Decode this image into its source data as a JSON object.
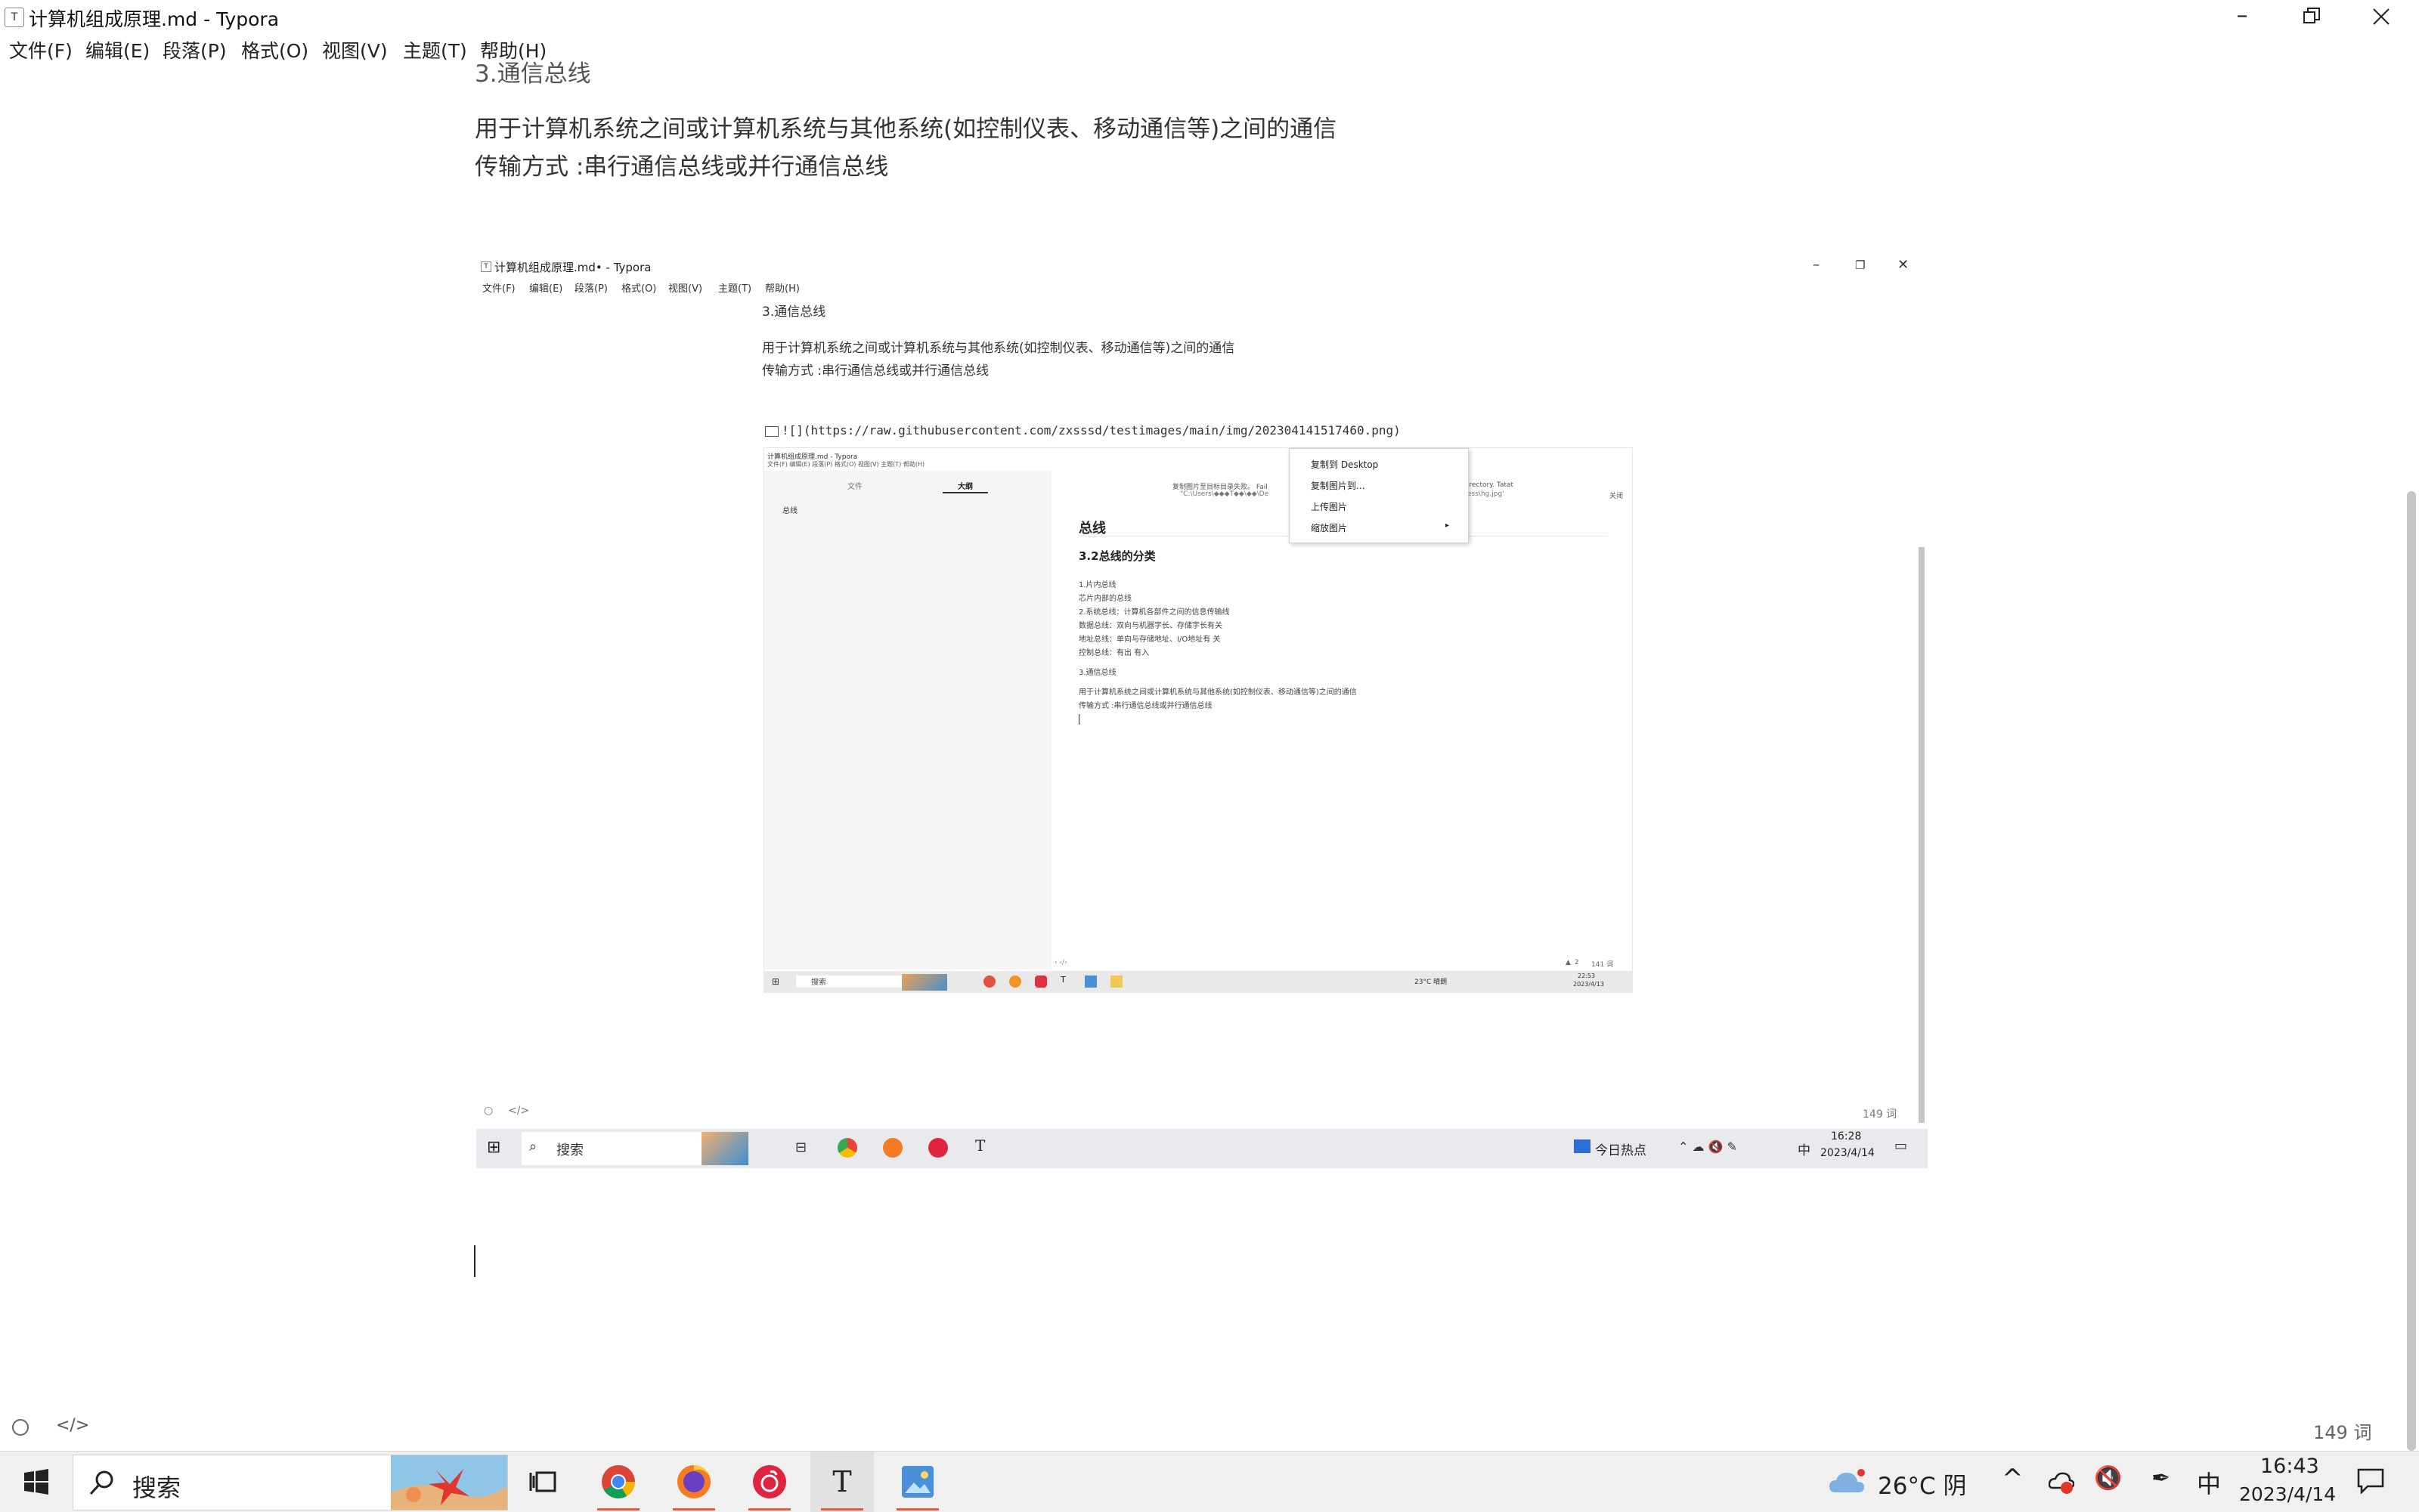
{
  "window": {
    "title": "计算机组成原理.md - Typora",
    "app_icon_letter": "T"
  },
  "menu": [
    "文件(F)",
    "编辑(E)",
    "段落(P)",
    "格式(O)",
    "视图(V)",
    "主题(T)",
    "帮助(H)"
  ],
  "doc": {
    "heading_partial": "3.通信总线",
    "line1": "用于计算机系统之间或计算机系统与其他系统(如控制仪表、移动通信等)之间的通信",
    "line2": "传输方式 :串行通信总线或并行通信总线"
  },
  "status": {
    "word_count": "149 词"
  },
  "taskbar": {
    "search_placeholder": "搜索",
    "weather": "26°C 阴",
    "ime": "中",
    "time": "16:43",
    "date": "2023/4/14"
  },
  "shot": {
    "title": "计算机组成原理.md• - Typora",
    "menu": [
      "文件(F)",
      "编辑(E)",
      "段落(P)",
      "格式(O)",
      "视图(V)",
      "主题(T)",
      "帮助(H)"
    ],
    "heading": "3.通信总线",
    "line1": "用于计算机系统之间或计算机系统与其他系统(如控制仪表、移动通信等)之间的通信",
    "line2": "传输方式 :串行通信总线或并行通信总线",
    "image_source": "![](https://raw.githubusercontent.com/zxsssd/testimages/main/img/202304141517460.png)",
    "word_count": "149 词",
    "taskbar_search": "搜索",
    "news": "今日热点",
    "ime": "中",
    "time": "16:28",
    "date": "2023/4/14"
  },
  "inner": {
    "title": "计算机组成原理.md - Typora",
    "menu": "文件(F)  编辑(E)  段落(P)  格式(O)  视图(V)  主题(T)  帮助(H)",
    "tab_files": "文件",
    "tab_outline": "大纲",
    "outline_item": "总线",
    "error_line1": "复制图片至目标目录失败。 Fail",
    "error_line2": "\"C:\\Users\\◆◆◆T◆◆\\◆◆\\De",
    "error_line3": "irectory. Tatat",
    "error_line4": "ess\\hg.jpg'",
    "close": "关闭",
    "h_total": "总线",
    "h_class": "3.2总线的分类",
    "lines": [
      "1.片内总线",
      "芯片内部的总线",
      "2.系统总线：计算机各部件之间的信息传输线",
      "数据总线：双向与机器字长、存储字长有关",
      "地址总线：单向与存储地址、I/O地址有 关",
      "控制总线：有出 有入"
    ],
    "sub3": "3.通信总线",
    "line1": "用于计算机系统之间或计算机系统与其他系统(如控制仪表、移动通信等)之间的通信",
    "line2": "传输方式 :串行通信总线或并行通信总线",
    "word_count": "141 词",
    "warn_count": "2",
    "search": "搜索",
    "weather": "23°C 晴朗",
    "time": "22:53",
    "date": "2023/4/13",
    "context_menu": [
      "复制到 Desktop",
      "复制图片到...",
      "上传图片",
      "缩放图片"
    ]
  }
}
